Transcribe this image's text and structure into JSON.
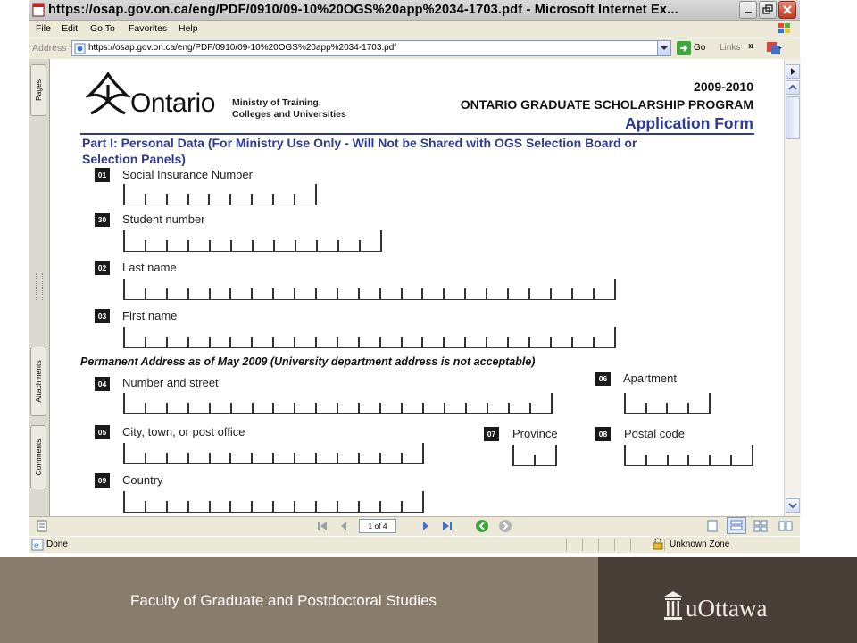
{
  "window": {
    "title": "https://osap.gov.on.ca/eng/PDF/0910/09-10%20OGS%20app%2034-1703.pdf - Microsoft Internet Ex...",
    "menu": [
      "File",
      "Edit",
      "Go To",
      "Favorites",
      "Help"
    ],
    "address_label": "Address",
    "address_url": "https://osap.gov.on.ca/eng/PDF/0910/09-10%20OGS%20app%2034-1703.pdf",
    "go_label": "Go",
    "links_label": "Links"
  },
  "side_tabs": [
    "Pages",
    "Attachments",
    "Comments"
  ],
  "document": {
    "brand": "Ontario",
    "ministry": [
      "Ministry of Training,",
      "Colleges and Universities"
    ],
    "year": "2009-2010",
    "program": "ONTARIO GRADUATE SCHOLARSHIP PROGRAM",
    "form_title": "Application Form",
    "part_heading": [
      "Part I: Personal Data (For Ministry Use Only - Will Not be Shared with OGS Selection Board or",
      "Selection Panels)"
    ],
    "address_heading": "Permanent Address as of May 2009 (University department address is not acceptable)",
    "fields": [
      {
        "num": "01",
        "label": "Social Insurance Number",
        "boxes": 9
      },
      {
        "num": "30",
        "label": "Student number",
        "boxes": 12
      },
      {
        "num": "02",
        "label": "Last name",
        "boxes": 23
      },
      {
        "num": "03",
        "label": "First name",
        "boxes": 23
      },
      {
        "num": "04",
        "label": "Number and street",
        "boxes": 20
      },
      {
        "num": "06",
        "label": "Apartment",
        "boxes": 4
      },
      {
        "num": "05",
        "label": "City, town, or post office",
        "boxes": 14
      },
      {
        "num": "07",
        "label": "Province",
        "boxes": 2
      },
      {
        "num": "08",
        "label": "Postal code",
        "boxes": 6
      },
      {
        "num": "09",
        "label": "Country",
        "boxes": 14
      }
    ]
  },
  "pdf_toolbar": {
    "page_indicator": "1 of 4"
  },
  "status": {
    "left": "Done",
    "zone": "Unknown Zone"
  },
  "footer": {
    "faculty": "Faculty of Graduate and Postdoctoral Studies",
    "logo_text": "uOttawa"
  },
  "colors": {
    "heading_blue": "#2f3a8f",
    "footer_left": "#8a7c6c",
    "footer_right": "#4a3f38"
  }
}
